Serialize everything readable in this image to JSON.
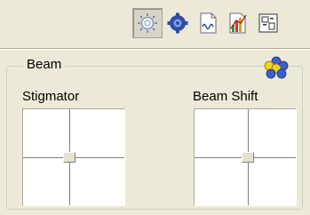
{
  "toolbar": {
    "buttons": [
      {
        "icon": "beam-sun-icon",
        "active": true
      },
      {
        "icon": "gear-blue-icon",
        "active": false
      },
      {
        "icon": "waveform-icon",
        "active": false
      },
      {
        "icon": "bar-chart-icon",
        "active": false
      },
      {
        "icon": "layout-grid-icon",
        "active": false
      }
    ]
  },
  "beam": {
    "title": "Beam",
    "stigmator_label": "Stigmator",
    "beam_shift_label": "Beam Shift"
  }
}
